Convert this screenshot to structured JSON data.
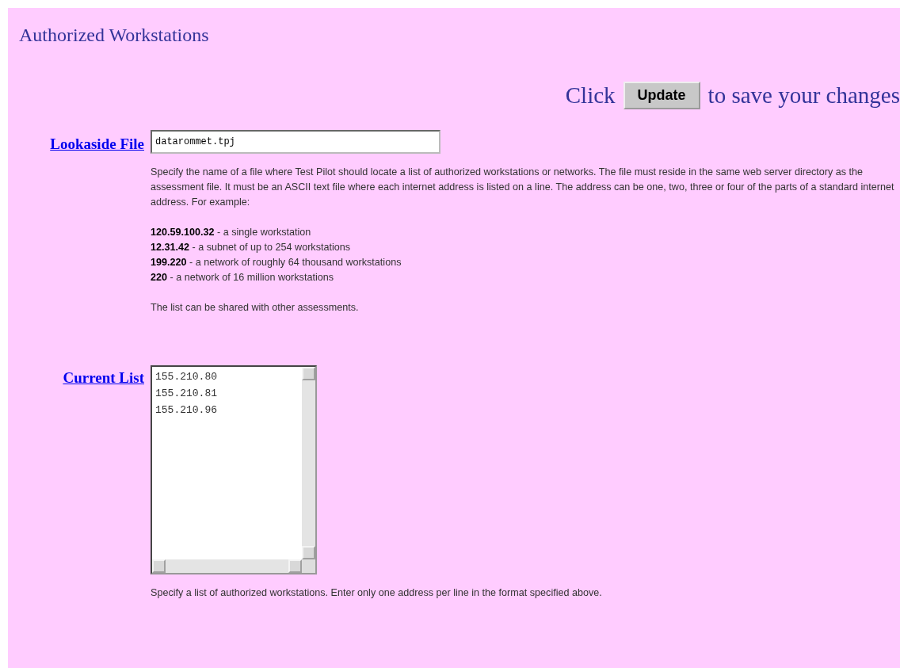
{
  "title": "Authorized Workstations",
  "update_prompt": {
    "before": "Click",
    "button": "Update",
    "after": "to save your changes"
  },
  "lookaside": {
    "label": "Lookaside File",
    "value": "datarommet.tpj",
    "description": "Specify the name of a file where Test Pilot should locate a list of authorized workstations or networks. The file must reside in the same web server directory as the assessment file. It must be an ASCII text file where each internet address is listed on a line. The address can be one, two, three or four of the parts of a standard internet address. For example:",
    "examples": [
      "**120.59.100.32** - a single workstation",
      "**12.31.42** - a subnet of up to 254 workstations",
      "**199.220** - a network of roughly 64 thousand workstations",
      "**220** - a network of 16 million workstations"
    ],
    "note": "The list can be shared with other assessments."
  },
  "current_list": {
    "label": "Current List",
    "lines": [
      "155.210.80",
      "155.210.81",
      "155.210.96"
    ],
    "description": "Specify a list of authorized workstations. Enter only one address per line in the format specified above."
  }
}
